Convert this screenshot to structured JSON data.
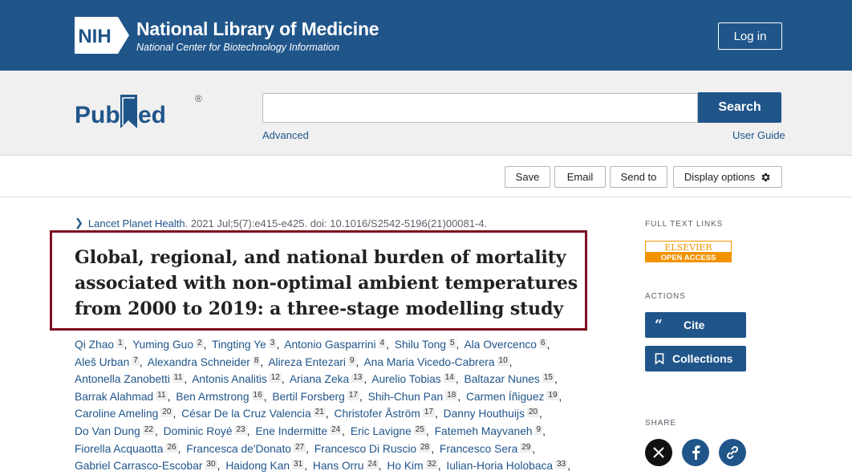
{
  "header": {
    "nih_badge": "NIH",
    "org_title": "National Library of Medicine",
    "org_subtitle": "National Center for Biotechnology Information",
    "login_label": "Log in"
  },
  "search": {
    "logo_text": "PubMed",
    "input_value": "",
    "button_label": "Search",
    "advanced_label": "Advanced",
    "user_guide_label": "User Guide"
  },
  "toolbar": {
    "save_label": "Save",
    "email_label": "Email",
    "send_to_label": "Send to",
    "display_options_label": "Display options"
  },
  "article": {
    "journal": "Lancet Planet Health",
    "citation_rest": ". 2021 Jul;5(7):e415-e425. doi: 10.1016/S2542-5196(21)00081-4.",
    "title": "Global, regional, and national burden of mortality associated with non-optimal ambient temperatures from 2000 to 2019: a three-stage modelling study",
    "authors": [
      {
        "name": "Qi Zhao",
        "aff": "1"
      },
      {
        "name": "Yuming Guo",
        "aff": "2"
      },
      {
        "name": "Tingting Ye",
        "aff": "3"
      },
      {
        "name": "Antonio Gasparrini",
        "aff": "4"
      },
      {
        "name": "Shilu Tong",
        "aff": "5"
      },
      {
        "name": "Ala Overcenco",
        "aff": "6"
      },
      {
        "name": "Aleš Urban",
        "aff": "7"
      },
      {
        "name": "Alexandra Schneider",
        "aff": "8"
      },
      {
        "name": "Alireza Entezari",
        "aff": "9"
      },
      {
        "name": "Ana Maria Vicedo-Cabrera",
        "aff": "10"
      },
      {
        "name": "Antonella Zanobetti",
        "aff": "11"
      },
      {
        "name": "Antonis Analitis",
        "aff": "12"
      },
      {
        "name": "Ariana Zeka",
        "aff": "13"
      },
      {
        "name": "Aurelio Tobias",
        "aff": "14"
      },
      {
        "name": "Baltazar Nunes",
        "aff": "15"
      },
      {
        "name": "Barrak Alahmad",
        "aff": "11"
      },
      {
        "name": "Ben Armstrong",
        "aff": "16"
      },
      {
        "name": "Bertil Forsberg",
        "aff": "17"
      },
      {
        "name": "Shih-Chun Pan",
        "aff": "18"
      },
      {
        "name": "Carmen Íñiguez",
        "aff": "19"
      },
      {
        "name": "Caroline Ameling",
        "aff": "20"
      },
      {
        "name": "César De la Cruz Valencia",
        "aff": "21"
      },
      {
        "name": "Christofer Åström",
        "aff": "17"
      },
      {
        "name": "Danny Houthuijs",
        "aff": "20"
      },
      {
        "name": "Do Van Dung",
        "aff": "22"
      },
      {
        "name": "Dominic Royé",
        "aff": "23"
      },
      {
        "name": "Ene Indermitte",
        "aff": "24"
      },
      {
        "name": "Eric Lavigne",
        "aff": "25"
      },
      {
        "name": "Fatemeh Mayvaneh",
        "aff": "9"
      },
      {
        "name": "Fiorella Acquaotta",
        "aff": "26"
      },
      {
        "name": "Francesca de'Donato",
        "aff": "27"
      },
      {
        "name": "Francesco Di Ruscio",
        "aff": "28"
      },
      {
        "name": "Francesco Sera",
        "aff": "29"
      },
      {
        "name": "Gabriel Carrasco-Escobar",
        "aff": "30"
      },
      {
        "name": "Haidong Kan",
        "aff": "31"
      },
      {
        "name": "Hans Orru",
        "aff": "24"
      },
      {
        "name": "Ho Kim",
        "aff": "32"
      },
      {
        "name": "Iulian-Horia Holobaca",
        "aff": "33"
      }
    ]
  },
  "sidebar": {
    "full_text_heading": "FULL TEXT LINKS",
    "elsevier_top": "ELSEVIER",
    "elsevier_bottom": "OPEN ACCESS",
    "actions_heading": "ACTIONS",
    "cite_label": "Cite",
    "collections_label": "Collections",
    "share_heading": "SHARE"
  },
  "colors": {
    "nlm_blue": "#20558a",
    "highlight_box": "#7b0f1f",
    "elsevier_orange": "#f39200"
  },
  "icons": [
    "nih-logo",
    "pubmed-logo",
    "chevron-right-icon",
    "gear-icon",
    "quote-icon",
    "bookmark-icon",
    "x-icon",
    "facebook-icon",
    "link-icon"
  ]
}
